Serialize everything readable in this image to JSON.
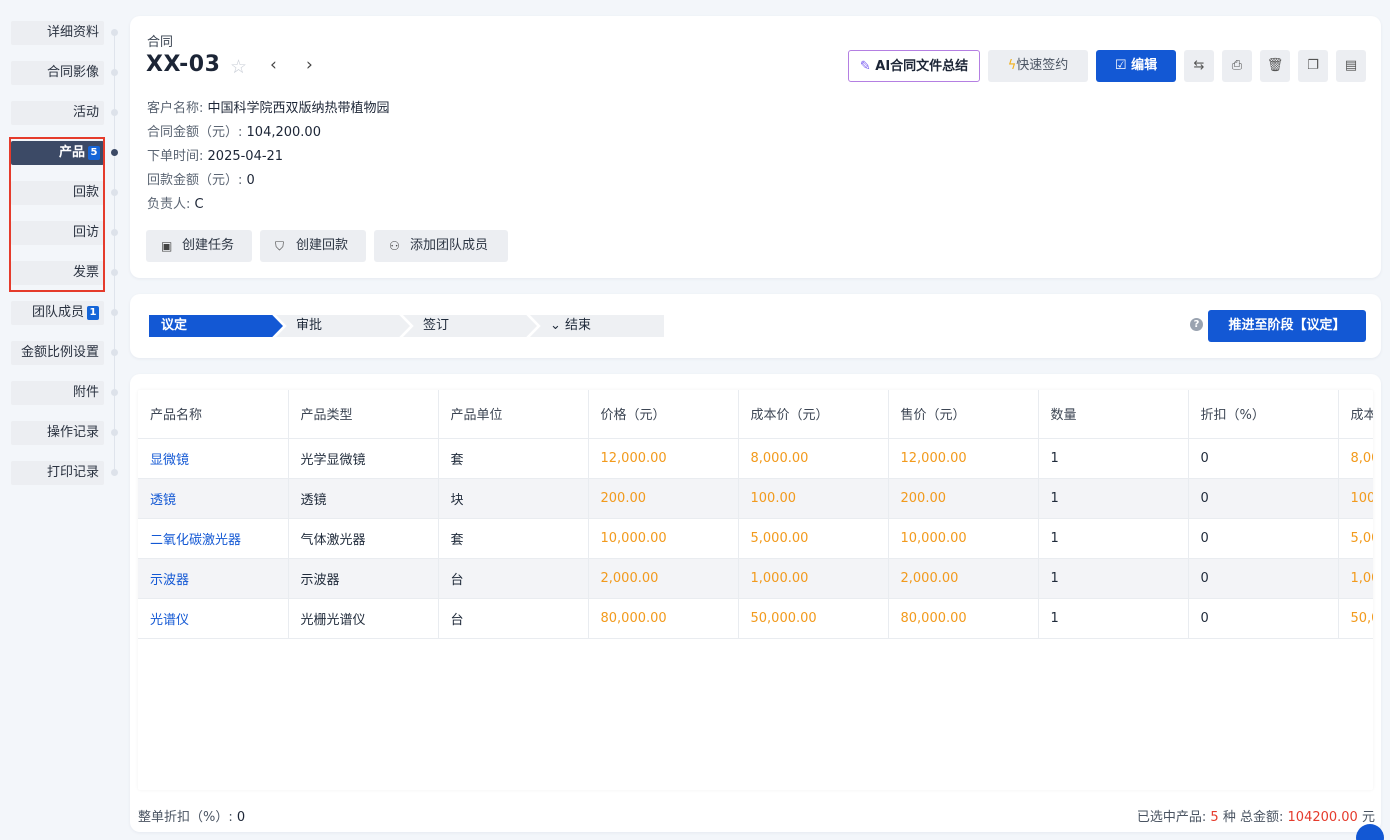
{
  "nav": {
    "items": [
      {
        "label": "详细资料"
      },
      {
        "label": "合同影像"
      },
      {
        "label": "活动"
      },
      {
        "label": "产品",
        "badge": "5",
        "active": true
      },
      {
        "label": "回款"
      },
      {
        "label": "回访"
      },
      {
        "label": "发票"
      },
      {
        "label": "团队成员",
        "badge": "1"
      },
      {
        "label": "金额比例设置"
      },
      {
        "label": "附件"
      },
      {
        "label": "操作记录"
      },
      {
        "label": "打印记录"
      }
    ]
  },
  "header": {
    "type": "合同",
    "title": "XX-03",
    "fields": [
      {
        "label": "客户名称:",
        "value": "中国科学院西双版纳热带植物园"
      },
      {
        "label": "合同金额（元）:",
        "value": "104,200.00"
      },
      {
        "label": "下单时间:",
        "value": "2025-04-21"
      },
      {
        "label": "回款金额（元）:",
        "value": "0"
      },
      {
        "label": "负责人:",
        "value": "C"
      }
    ],
    "actions": {
      "ai_summary": "AI合同文件总结",
      "quick_sign": "快速签约",
      "edit": "编辑"
    },
    "sub_actions": {
      "create_task": "创建任务",
      "create_payment": "创建回款",
      "add_member": "添加团队成员"
    }
  },
  "stages": {
    "items": [
      "议定",
      "审批",
      "签订",
      "结束"
    ],
    "current": "议定",
    "advance_label": "推进至阶段【议定】"
  },
  "table": {
    "columns": [
      "产品名称",
      "产品类型",
      "产品单位",
      "价格（元）",
      "成本价（元）",
      "售价（元）",
      "数量",
      "折扣（%）",
      "成本"
    ],
    "rows": [
      [
        "显微镜",
        "光学显微镜",
        "套",
        "12,000.00",
        "8,000.00",
        "12,000.00",
        "1",
        "0",
        "8,00"
      ],
      [
        "透镜",
        "透镜",
        "块",
        "200.00",
        "100.00",
        "200.00",
        "1",
        "0",
        "100."
      ],
      [
        "二氧化碳激光器",
        "气体激光器",
        "套",
        "10,000.00",
        "5,000.00",
        "10,000.00",
        "1",
        "0",
        "5,00"
      ],
      [
        "示波器",
        "示波器",
        "台",
        "2,000.00",
        "1,000.00",
        "2,000.00",
        "1",
        "0",
        "1,00"
      ],
      [
        "光谱仪",
        "光栅光谱仪",
        "台",
        "80,000.00",
        "50,000.00",
        "80,000.00",
        "1",
        "0",
        "50,0"
      ]
    ]
  },
  "footer": {
    "discount_label": "整单折扣（%）:",
    "discount_value": "0",
    "selected_prefix": "已选中产品:",
    "selected_count": "5",
    "count_unit": "种",
    "total_label": "总金额:",
    "total_value": "104200.00",
    "total_unit": "元"
  }
}
